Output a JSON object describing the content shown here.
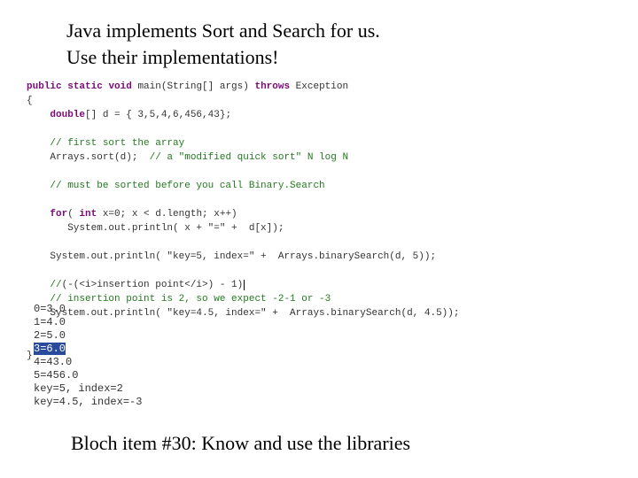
{
  "heading": {
    "line1": "Java implements Sort and Search for us.",
    "line2": "Use their implementations!"
  },
  "code": {
    "signature": {
      "kw_public": "public",
      "kw_static": "static",
      "kw_void": "void",
      "name": " main(String[] args) ",
      "kw_throws": "throws",
      "exc": " Exception"
    },
    "brace_open": "{",
    "decl": {
      "indent": "    ",
      "kw_double": "double",
      "rest": "[] d = { 3,5,4,6,456,43};"
    },
    "c_first": "    // first sort the array",
    "sort_call": "    Arrays.sort(d);  ",
    "c_sort": "// a \"modified quick sort\" N log N",
    "c_mustSorted": "    // must be sorted before you call Binary.Search",
    "for_line": {
      "indent": "    ",
      "kw_for": "for",
      "open": "( ",
      "kw_int": "int",
      "rest": " x=0; x < d.length; x++)"
    },
    "for_body": "       System.out.println( x + \"=\" +  d[x]);",
    "bs1": "    System.out.println( \"key=5, index=\" +  Arrays.binarySearch(d, 5));",
    "c_formula": {
      "indent": "    ",
      "slashes": "//",
      "body": "(-(<i>insertion point</i>) - 1)"
    },
    "c_expect": "    // insertion point is 2, so we expect -2-1 or -3",
    "bs2": "    System.out.println( \"key=4.5, index=\" +  Arrays.binarySearch(d, 4.5));",
    "brace_close": "}"
  },
  "output": {
    "l1": "0=3.0",
    "l2": "1=4.0",
    "l3": "2=5.0",
    "l4": "3=6.0",
    "l5": "4=43.0",
    "l6": "5=456.0",
    "l7": "key=5, index=2",
    "l8": "key=4.5, index=-3"
  },
  "footnote": "Bloch item #30:  Know and use the libraries"
}
